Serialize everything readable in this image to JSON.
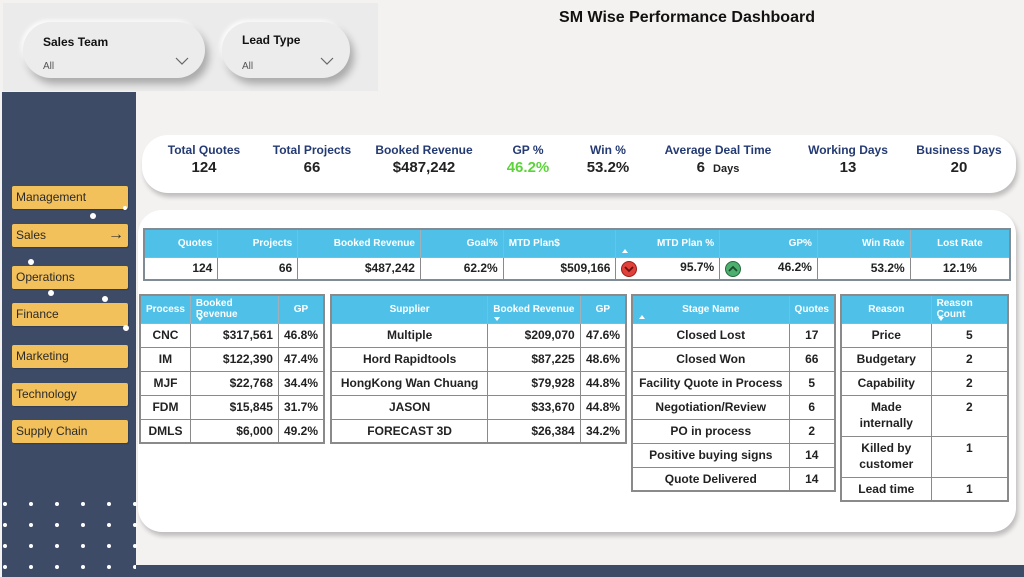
{
  "title": "SM Wise Performance Dashboard",
  "filters": [
    {
      "label": "Sales Team",
      "value": "All"
    },
    {
      "label": "Lead Type",
      "value": "All"
    }
  ],
  "sidebar": {
    "items": [
      {
        "label": "Management"
      },
      {
        "label": "Sales",
        "active": true,
        "icon": "arrow-right-icon"
      },
      {
        "label": "Operations"
      },
      {
        "label": "Finance"
      },
      {
        "label": "Marketing"
      },
      {
        "label": "Technology"
      },
      {
        "label": "Supply Chain"
      }
    ]
  },
  "kpis": [
    {
      "label": "Total Quotes",
      "value": "124"
    },
    {
      "label": "Total Projects",
      "value": "66"
    },
    {
      "label": "Booked Revenue",
      "value": "$487,242"
    },
    {
      "label": "GP %",
      "value": "46.2%",
      "color": "#5cd33b"
    },
    {
      "label": "Win %",
      "value": "53.2%"
    },
    {
      "label": "Average Deal Time",
      "value": "6",
      "unit": "Days"
    },
    {
      "label": "Working Days",
      "value": "13"
    },
    {
      "label": "Business Days",
      "value": "20"
    }
  ],
  "summary": {
    "headers": [
      "Quotes",
      "Projects",
      "Booked Revenue",
      "Goal%",
      "MTD Plan$",
      "MTD Plan %",
      "GP%",
      "Win Rate",
      "Lost Rate"
    ],
    "row": {
      "quotes": "124",
      "projects": "66",
      "booked_revenue": "$487,242",
      "goal_pct": "62.2%",
      "mtd_plan_dollars": "$509,166",
      "mtd_plan_pct": "95.7%",
      "mtd_plan_pct_indicator": "down-red",
      "gp_pct": "46.2%",
      "gp_pct_indicator": "up-green",
      "win_rate": "53.2%",
      "lost_rate": "12.1%"
    }
  },
  "process_table": {
    "headers": [
      "Process",
      "Booked Revenue",
      "GP"
    ],
    "rows": [
      [
        "CNC",
        "$317,561",
        "46.8%"
      ],
      [
        "IM",
        "$122,390",
        "47.4%"
      ],
      [
        "MJF",
        "$22,768",
        "34.4%"
      ],
      [
        "FDM",
        "$15,845",
        "31.7%"
      ],
      [
        "DMLS",
        "$6,000",
        "49.2%"
      ]
    ]
  },
  "supplier_table": {
    "headers": [
      "Supplier",
      "Booked Revenue",
      "GP"
    ],
    "rows": [
      [
        "Multiple",
        "$209,070",
        "47.6%"
      ],
      [
        "Hord Rapidtools",
        "$87,225",
        "48.6%"
      ],
      [
        "HongKong Wan Chuang",
        "$79,928",
        "44.8%"
      ],
      [
        "JASON",
        "$33,670",
        "44.8%"
      ],
      [
        "FORECAST 3D",
        "$26,384",
        "34.2%"
      ]
    ]
  },
  "stage_table": {
    "headers": [
      "Stage Name",
      "Quotes"
    ],
    "rows": [
      [
        "Closed Lost",
        "17"
      ],
      [
        "Closed Won",
        "66"
      ],
      [
        "Facility Quote in Process",
        "5"
      ],
      [
        "Negotiation/Review",
        "6"
      ],
      [
        "PO in process",
        "2"
      ],
      [
        "Positive buying signs",
        "14"
      ],
      [
        "Quote Delivered",
        "14"
      ]
    ]
  },
  "reason_table": {
    "headers": [
      "Reason",
      "Reason Count"
    ],
    "rows": [
      [
        "Price",
        "5"
      ],
      [
        "Budgetary",
        "2"
      ],
      [
        "Capability",
        "2"
      ],
      [
        "Made internally",
        "2"
      ],
      [
        "Killed by customer",
        "1"
      ],
      [
        "Lead time",
        "1"
      ]
    ]
  }
}
